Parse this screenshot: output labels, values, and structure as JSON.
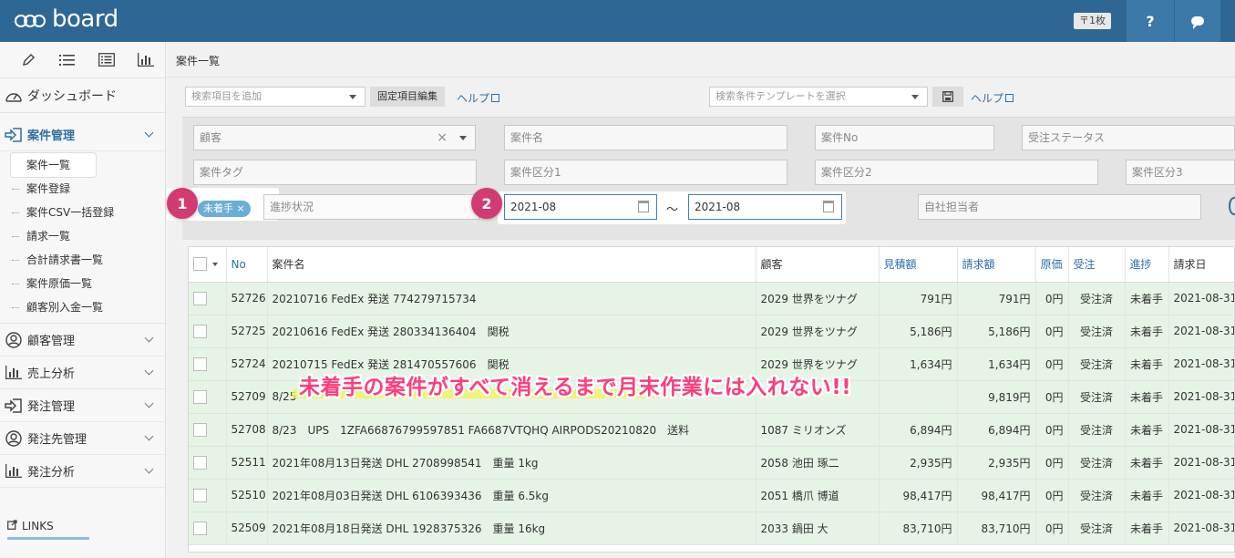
{
  "app": {
    "logo_text": "board",
    "count_badge": "〒1枚",
    "help_label": "?"
  },
  "sidebar": {
    "tools": [
      "pencil-icon",
      "list-icon",
      "table-list-icon",
      "bar-chart-icon"
    ],
    "dashboard": "ダッシュボード",
    "sections": [
      {
        "label": "案件管理",
        "icon": "login-icon"
      },
      {
        "label": "顧客管理",
        "icon": "user-circle-icon"
      },
      {
        "label": "売上分析",
        "icon": "bar-chart-icon"
      },
      {
        "label": "発注管理",
        "icon": "login-icon"
      },
      {
        "label": "発注先管理",
        "icon": "user-circle-icon"
      },
      {
        "label": "発注分析",
        "icon": "bar-chart-icon"
      }
    ],
    "sub_items": [
      "案件一覧",
      "案件登録",
      "案件CSV一括登録",
      "請求一覧",
      "合計請求書一覧",
      "案件原価一覧",
      "顧客別入金一覧"
    ],
    "links_label": "LINKS"
  },
  "main": {
    "page_title": "案件一覧",
    "search_add_placeholder": "検索項目を追加",
    "fixed_edit_label": "固定項目編集",
    "help_label": "ヘルプ",
    "template_placeholder": "検索条件テンプレートを選択",
    "filters": {
      "customer": "顧客",
      "project_name": "案件名",
      "project_no": "案件No",
      "order_status": "受注ステータス",
      "project_tag": "案件タグ",
      "category1": "案件区分1",
      "category2": "案件区分2",
      "category3": "案件区分3",
      "progress_tag": "未着手 ×",
      "progress_status": "進捗状況",
      "date_from": "2021-08",
      "date_sep": "〜",
      "date_to": "2021-08",
      "assignee": "自社担当者"
    },
    "markers": [
      "1",
      "2"
    ]
  },
  "table": {
    "headers": [
      "No",
      "案件名",
      "顧客",
      "見積額",
      "請求額",
      "原価",
      "受注",
      "進捗",
      "請求日"
    ],
    "rows": [
      [
        "52726",
        "20210716 FedEx 発送 774279715734",
        "2029 世界をツナグ",
        "791円",
        "791円",
        "0円",
        "受注済",
        "未着手",
        "2021-08-31"
      ],
      [
        "52725",
        "20210616 FedEx 発送 280334136404　関税",
        "2029 世界をツナグ",
        "5,186円",
        "5,186円",
        "0円",
        "受注済",
        "未着手",
        "2021-08-31"
      ],
      [
        "52724",
        "20210715 FedEx 発送 281470557606　関税",
        "2029 世界をツナグ",
        "1,634円",
        "1,634円",
        "0円",
        "受注済",
        "未着手",
        "2021-08-31"
      ],
      [
        "52709",
        "8/25",
        "",
        "",
        "9,819円",
        "0円",
        "受注済",
        "未着手",
        "2021-08-31"
      ],
      [
        "52708",
        "8/23　UPS　1ZFA66876799597851 FA6687VTQHQ AIRPODS20210820　送料",
        "1087 ミリオンズ",
        "6,894円",
        "6,894円",
        "0円",
        "受注済",
        "未着手",
        "2021-08-31"
      ],
      [
        "52511",
        "2021年08月13日発送 DHL 2708998541　重量 1kg",
        "2058 池田 琢二",
        "2,935円",
        "2,935円",
        "0円",
        "受注済",
        "未着手",
        "2021-08-31"
      ],
      [
        "52510",
        "2021年08月03日発送 DHL 6106393436　重量 6.5kg",
        "2051 橋爪 博道",
        "98,417円",
        "98,417円",
        "0円",
        "受注済",
        "未着手",
        "2021-08-31"
      ],
      [
        "52509",
        "2021年08月18日発送 DHL 1928375326　重量 16kg",
        "2033 鍋田 大",
        "83,710円",
        "83,710円",
        "0円",
        "受注済",
        "未着手",
        "2021-08-31"
      ]
    ]
  },
  "overlay_message": "未着手の案件がすべて消えるまで月末作業には入れない!!",
  "colors": {
    "topbar": "#2e6794",
    "accent": "#2e6ea6",
    "marker": "#d23a72",
    "row_bg": "#e6f4e6",
    "overlay_text": "#ff3c7a"
  }
}
